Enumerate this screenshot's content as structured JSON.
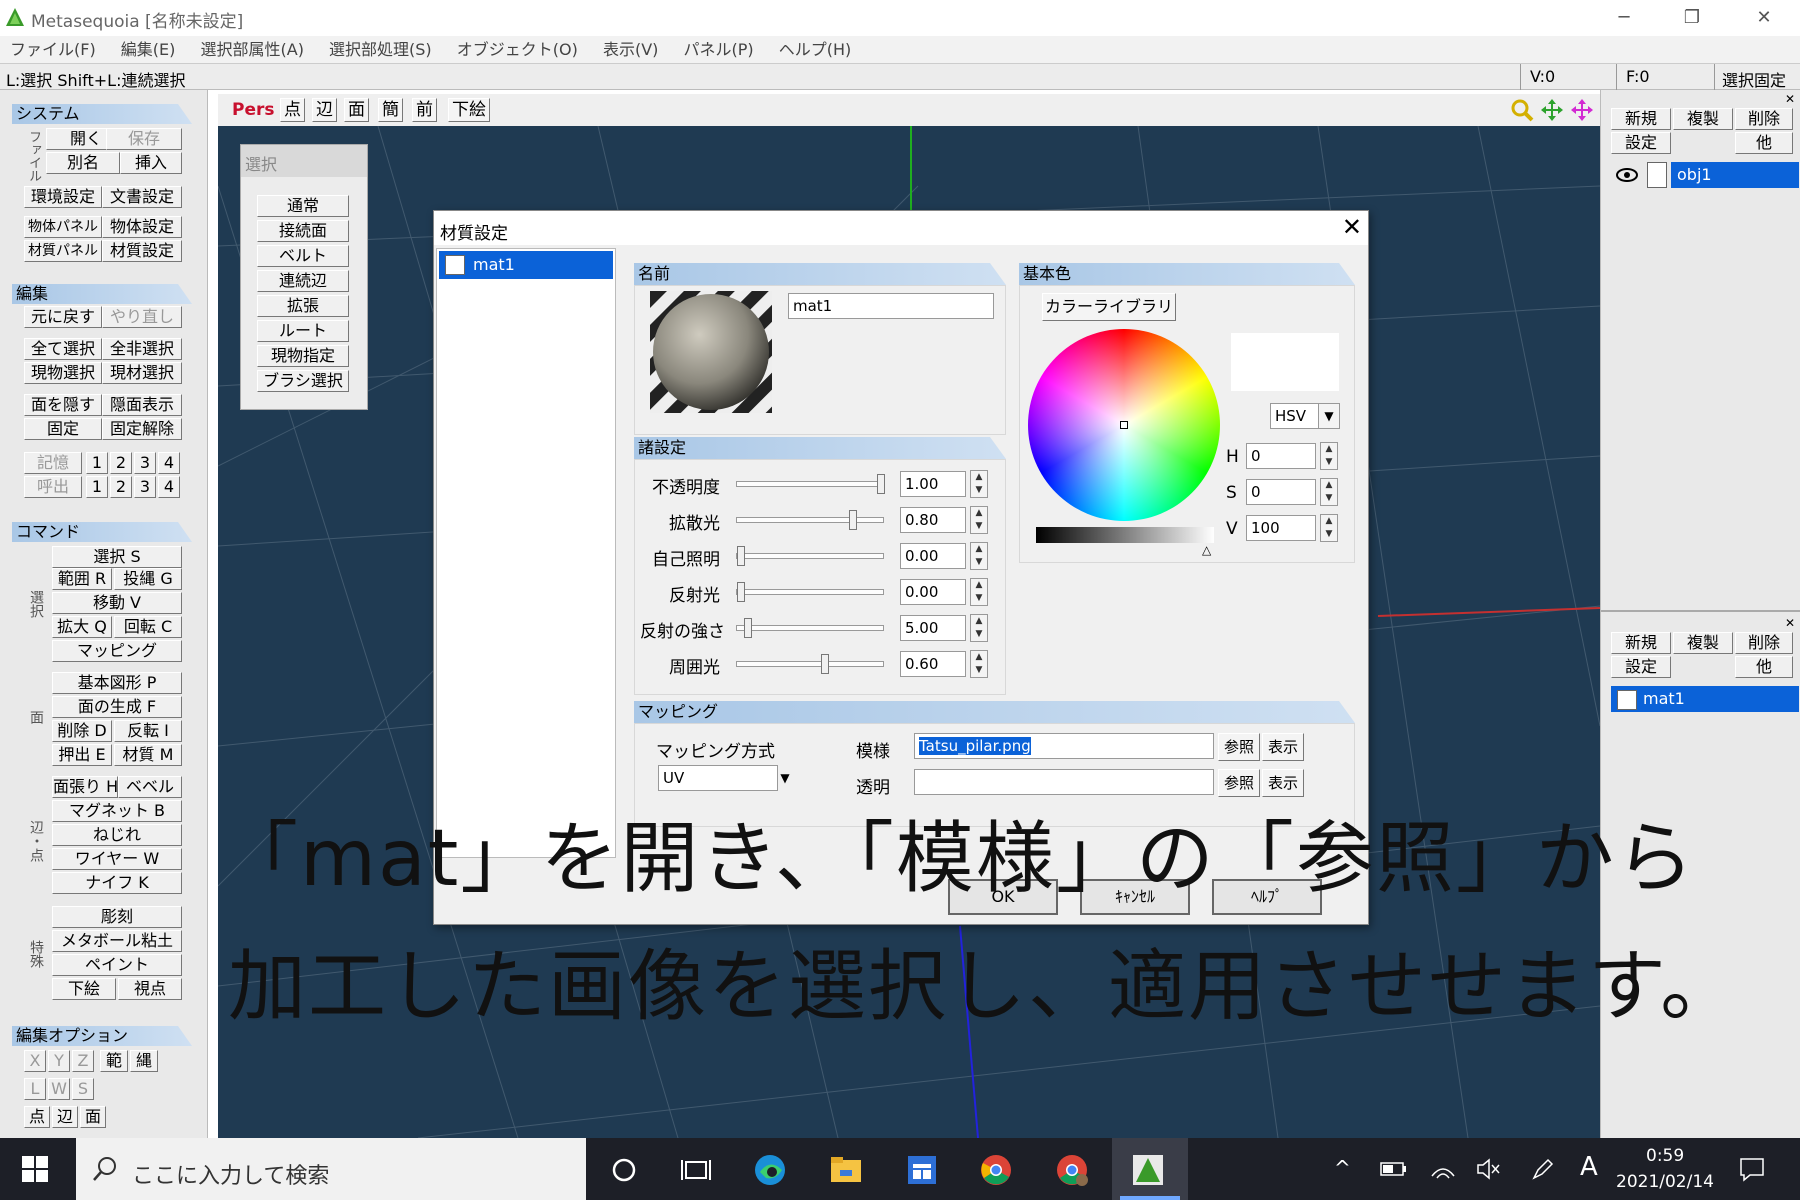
{
  "app": {
    "title": "Metasequoia [名称未設定]",
    "window_controls": {
      "minimize": "─",
      "restore": "❐",
      "close": "✕"
    }
  },
  "menubar": [
    "ファイル(F)",
    "編集(E)",
    "選択部属性(A)",
    "選択部処理(S)",
    "オブジェクト(O)",
    "表示(V)",
    "パネル(P)",
    "ヘルプ(H)"
  ],
  "statusbar": {
    "hint": "L:選択  Shift+L:連続選択",
    "vertex": "V:0",
    "face": "F:0",
    "lock": "選択固定"
  },
  "left_panel": {
    "system": {
      "header": "システム",
      "file_label": "ファイル",
      "open": "開く",
      "save": "保存",
      "save_as": "別名",
      "insert": "挿入",
      "env": "環境設定",
      "doc": "文書設定",
      "obj_panel": "物体パネル",
      "obj_settings": "物体設定",
      "mat_panel": "材質パネル",
      "mat_settings": "材質設定"
    },
    "edit": {
      "header": "編集",
      "undo": "元に戻す",
      "redo": "やり直し",
      "select_all": "全て選択",
      "select_none": "全非選択",
      "cur_obj_select": "現物選択",
      "cur_mat_select": "現材選択",
      "hide_face": "面を隠す",
      "show_hidden": "隠面表示",
      "fix": "固定",
      "unfix": "固定解除",
      "memory": "記憶",
      "recall": "呼出",
      "nums": [
        "1",
        "2",
        "3",
        "4"
      ]
    },
    "command": {
      "header": "コマンド",
      "group1_label": "選択",
      "select": "選択 S",
      "range": "範囲 R",
      "lasso": "投縄 G",
      "move": "移動 V",
      "scale": "拡大 Q",
      "rotate": "回転 C",
      "mapping": "マッピング",
      "group2_label": "面",
      "basic_shape": "基本図形 P",
      "gen_face": "面の生成 F",
      "delete": "削除 D",
      "flip": "反転 I",
      "extrude": "押出 E",
      "material": "材質 M",
      "group3_label": "辺・点",
      "stretch": "面張り H",
      "bevel": "ベベル",
      "magnet": "マグネット B",
      "twist": "ねじれ",
      "wire": "ワイヤー W",
      "knife": "ナイフ K",
      "group4_label": "特殊",
      "sculpt": "彫刻",
      "metaball": "メタボール粘土",
      "paint": "ペイント",
      "underlay": "下絵",
      "viewpoint": "視点"
    },
    "edit_options": {
      "header": "編集オプション",
      "x": "X",
      "y": "Y",
      "z": "Z",
      "range": "範",
      "rope": "縄",
      "l": "L",
      "w": "W",
      "s": "S",
      "point": "点",
      "edge": "辺",
      "face": "面"
    }
  },
  "viewport": {
    "mode": "Pers",
    "toolbar": [
      "点",
      "辺",
      "面",
      "簡",
      "前",
      "下絵"
    ]
  },
  "select_panel": {
    "title": "選択",
    "items": [
      "通常",
      "接続面",
      "ベルト",
      "連続辺",
      "拡張",
      "ルート",
      "現物指定",
      "ブラシ選択"
    ]
  },
  "object_panel": {
    "new": "新規",
    "dup": "複製",
    "del": "削除",
    "settings": "設定",
    "other": "他",
    "object_name": "obj1"
  },
  "material_panel": {
    "new": "新規",
    "dup": "複製",
    "del": "削除",
    "settings": "設定",
    "other": "他",
    "material_name": "mat1"
  },
  "dialog": {
    "title": "材質設定",
    "list_item": "mat1",
    "name_group": "名前",
    "name_value": "mat1",
    "color_group": "基本色",
    "color_library": "カラーライブラリ",
    "color_model": "HSV",
    "h_label": "H",
    "h_value": "0",
    "s_label": "S",
    "s_value": "0",
    "v_label": "V",
    "v_value": "100",
    "settings_group": "諸設定",
    "params": [
      {
        "label": "不透明度",
        "value": "1.00",
        "level": 1.0
      },
      {
        "label": "拡散光",
        "value": "0.80",
        "level": 0.8
      },
      {
        "label": "自己照明",
        "value": "0.00",
        "level": 0.0
      },
      {
        "label": "反射光",
        "value": "0.00",
        "level": 0.0
      },
      {
        "label": "反射の強さ",
        "value": "5.00",
        "level": 0.05
      },
      {
        "label": "周囲光",
        "value": "0.60",
        "level": 0.6
      }
    ],
    "mapping_group": "マッピング",
    "mapping_method_label": "マッピング方式",
    "mapping_method": "UV",
    "pattern_label": "模様",
    "pattern_value": "Tatsu_pilar.png",
    "alpha_label": "透明",
    "alpha_value": "",
    "browse": "参照",
    "view": "表示",
    "ok": "OK",
    "cancel": "ｷｬﾝｾﾙ",
    "help": "ﾍﾙﾌﾟ"
  },
  "caption": {
    "line1": "「mat」を開き、「模様」の「参照」から",
    "line2": "加工した画像を選択し、適用させせます。"
  },
  "taskbar": {
    "search_placeholder": "ここに入力して検索",
    "time": "0:59",
    "date": "2021/02/14",
    "ime": "A"
  }
}
